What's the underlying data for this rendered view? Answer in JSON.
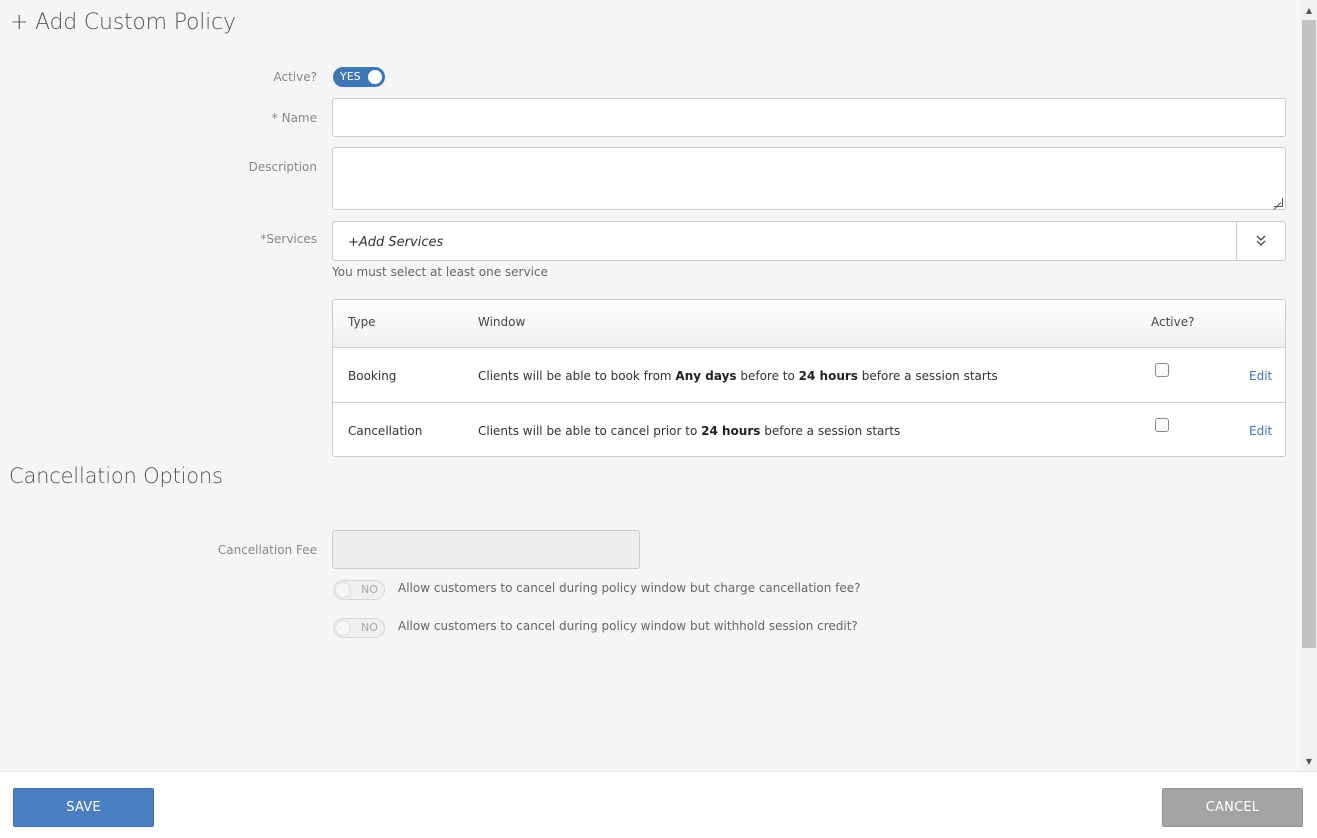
{
  "page": {
    "title": "+ Add Custom Policy",
    "accent_color": "#3e77b6"
  },
  "form": {
    "active_label": "Active?",
    "active_toggle": "YES",
    "name_label": "* Name",
    "name_value": "",
    "description_label": "Description",
    "description_value": "",
    "services_label": "*Services",
    "services_placeholder": "+Add Services",
    "services_hint": "You must select at least one service"
  },
  "window_table": {
    "headers": {
      "type": "Type",
      "window": "Window",
      "active": "Active?"
    },
    "rows": [
      {
        "type": "Booking",
        "window_prefix": "Clients will be able to book from ",
        "window_bold1": "Any days",
        "window_mid": " before to ",
        "window_bold2": "24 hours",
        "window_suffix": " before a session starts",
        "active": false,
        "edit_label": "Edit"
      },
      {
        "type": "Cancellation",
        "window_prefix": "Clients will be able to cancel prior to ",
        "window_bold1": "24 hours",
        "window_suffix": " before a session starts",
        "active": false,
        "edit_label": "Edit"
      }
    ]
  },
  "cancellation": {
    "section_title": "Cancellation Options",
    "fee_label": "Cancellation Fee",
    "fee_value": "",
    "option1_toggle": "NO",
    "option1_text": "Allow customers to cancel during policy window but charge cancellation fee?",
    "option2_toggle": "NO",
    "option2_text": "Allow customers to cancel during policy window but withhold session credit?"
  },
  "footer": {
    "save_label": "SAVE",
    "cancel_label": "CANCEL"
  }
}
